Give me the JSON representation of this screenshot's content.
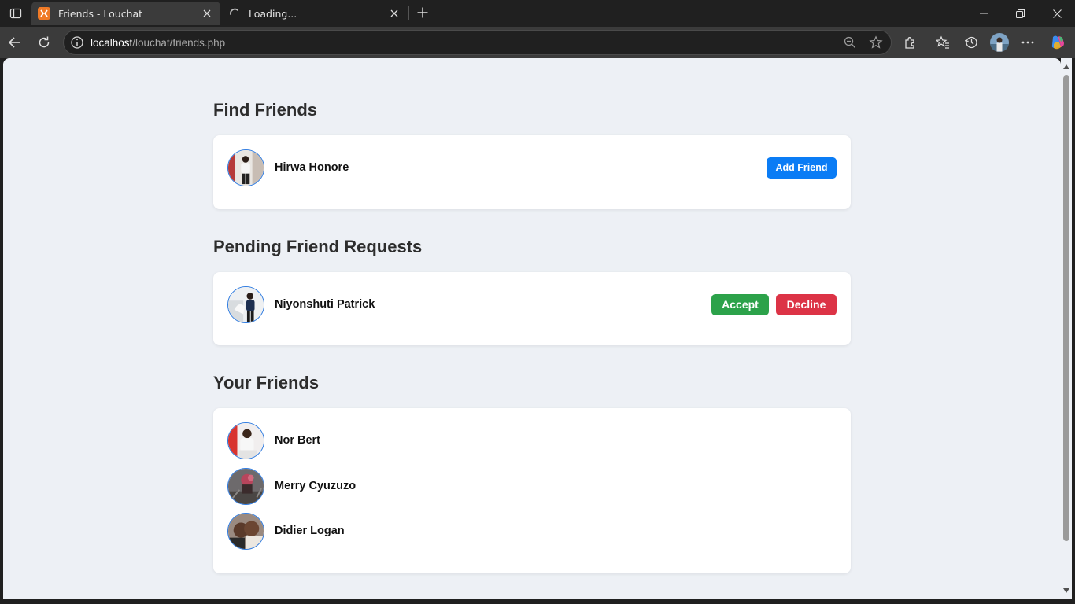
{
  "browser": {
    "tabs": [
      {
        "title": "Friends - Louchat",
        "active": true
      },
      {
        "title": "Loading...",
        "active": false
      }
    ],
    "address": {
      "host": "localhost",
      "path": "/louchat/friends.php"
    },
    "colors": {
      "chrome": "#202020",
      "toolbar": "#3b3b3b",
      "page_bg": "#edf0f5"
    }
  },
  "page": {
    "find_friends": {
      "title": "Find Friends",
      "users": [
        {
          "name": "Hirwa Honore",
          "action_label": "Add Friend"
        }
      ]
    },
    "pending_requests": {
      "title": "Pending Friend Requests",
      "requests": [
        {
          "name": "Niyonshuti Patrick",
          "accept_label": "Accept",
          "decline_label": "Decline"
        }
      ]
    },
    "your_friends": {
      "title": "Your Friends",
      "friends": [
        {
          "name": "Nor Bert"
        },
        {
          "name": "Merry Cyuzuzo"
        },
        {
          "name": "Didier Logan"
        }
      ]
    },
    "colors": {
      "add_button": "#0a7cf5",
      "accept_button": "#2ca24a",
      "decline_button": "#dc3346",
      "avatar_border": "#2e7be0"
    }
  }
}
